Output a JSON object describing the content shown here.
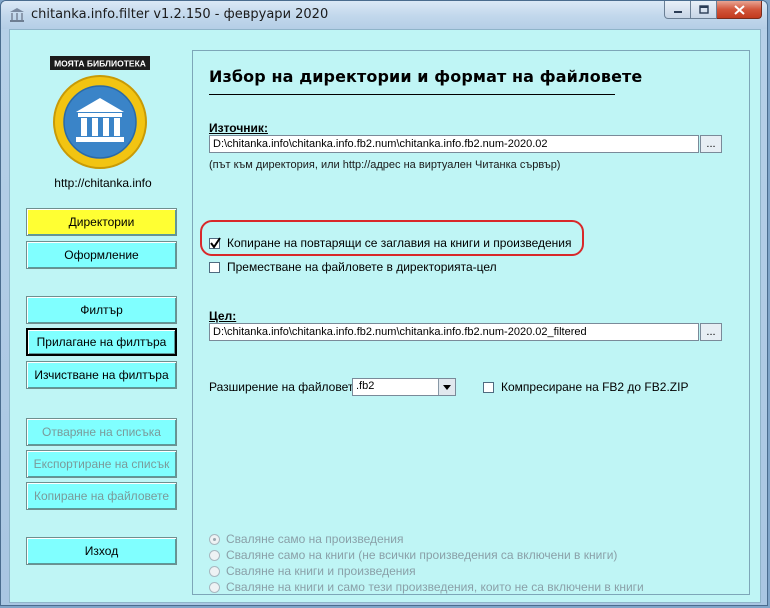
{
  "window": {
    "title": "chitanka.info.filter v1.2.150 - февруари 2020"
  },
  "sidebar": {
    "logo_text": "МОЯТА БИБЛИОТЕКА",
    "url": "http://chitanka.info",
    "buttons": {
      "directories": "Директории",
      "formatting": "Оформление",
      "filter": "Филтър",
      "apply_filter": "Прилагане на филтъра",
      "clear_filter": "Изчистване на филтъра",
      "open_list": "Отваряне на списъка",
      "export_list": "Експортиране на списък",
      "copy_files": "Копиране на файловете",
      "exit": "Изход"
    }
  },
  "main": {
    "title": "Избор на директории и формат на файловете",
    "source": {
      "label": "Източник:",
      "value": "D:\\chitanka.info\\chitanka.info.fb2.num\\chitanka.info.fb2.num-2020.02",
      "browse_label": "...",
      "hint": "(път към директория, или http://адрес на виртуален Читанка сървър)"
    },
    "options": {
      "copy_duplicates": {
        "label": "Копиране на повтарящи се заглавия на книги и произведения",
        "checked": true
      },
      "move_files": {
        "label": "Преместване на файловете в директорията-цел",
        "checked": false
      }
    },
    "target": {
      "label": "Цел:",
      "value": "D:\\chitanka.info\\chitanka.info.fb2.num\\chitanka.info.fb2.num-2020.02_filtered",
      "browse_label": "..."
    },
    "extension": {
      "label": "Разширение на файловете:",
      "value": ".fb2",
      "compress_label": "Компресиране на FB2 до FB2.ZIP",
      "compress_checked": false
    },
    "download_options": [
      {
        "label": "Сваляне само на произведения",
        "checked": true
      },
      {
        "label": "Сваляне само на книги (не всички произведения са включени в книги)",
        "checked": false
      },
      {
        "label": "Сваляне на книги и произведения",
        "checked": false
      },
      {
        "label": "Сваляне на книги и само тези произведения, които не са включени в книги",
        "checked": false
      }
    ]
  },
  "colors": {
    "client_bg": "#bff5f5",
    "button_bg": "#80ffff",
    "active_button_bg": "#ffff33",
    "highlight_border": "#d8282a"
  }
}
